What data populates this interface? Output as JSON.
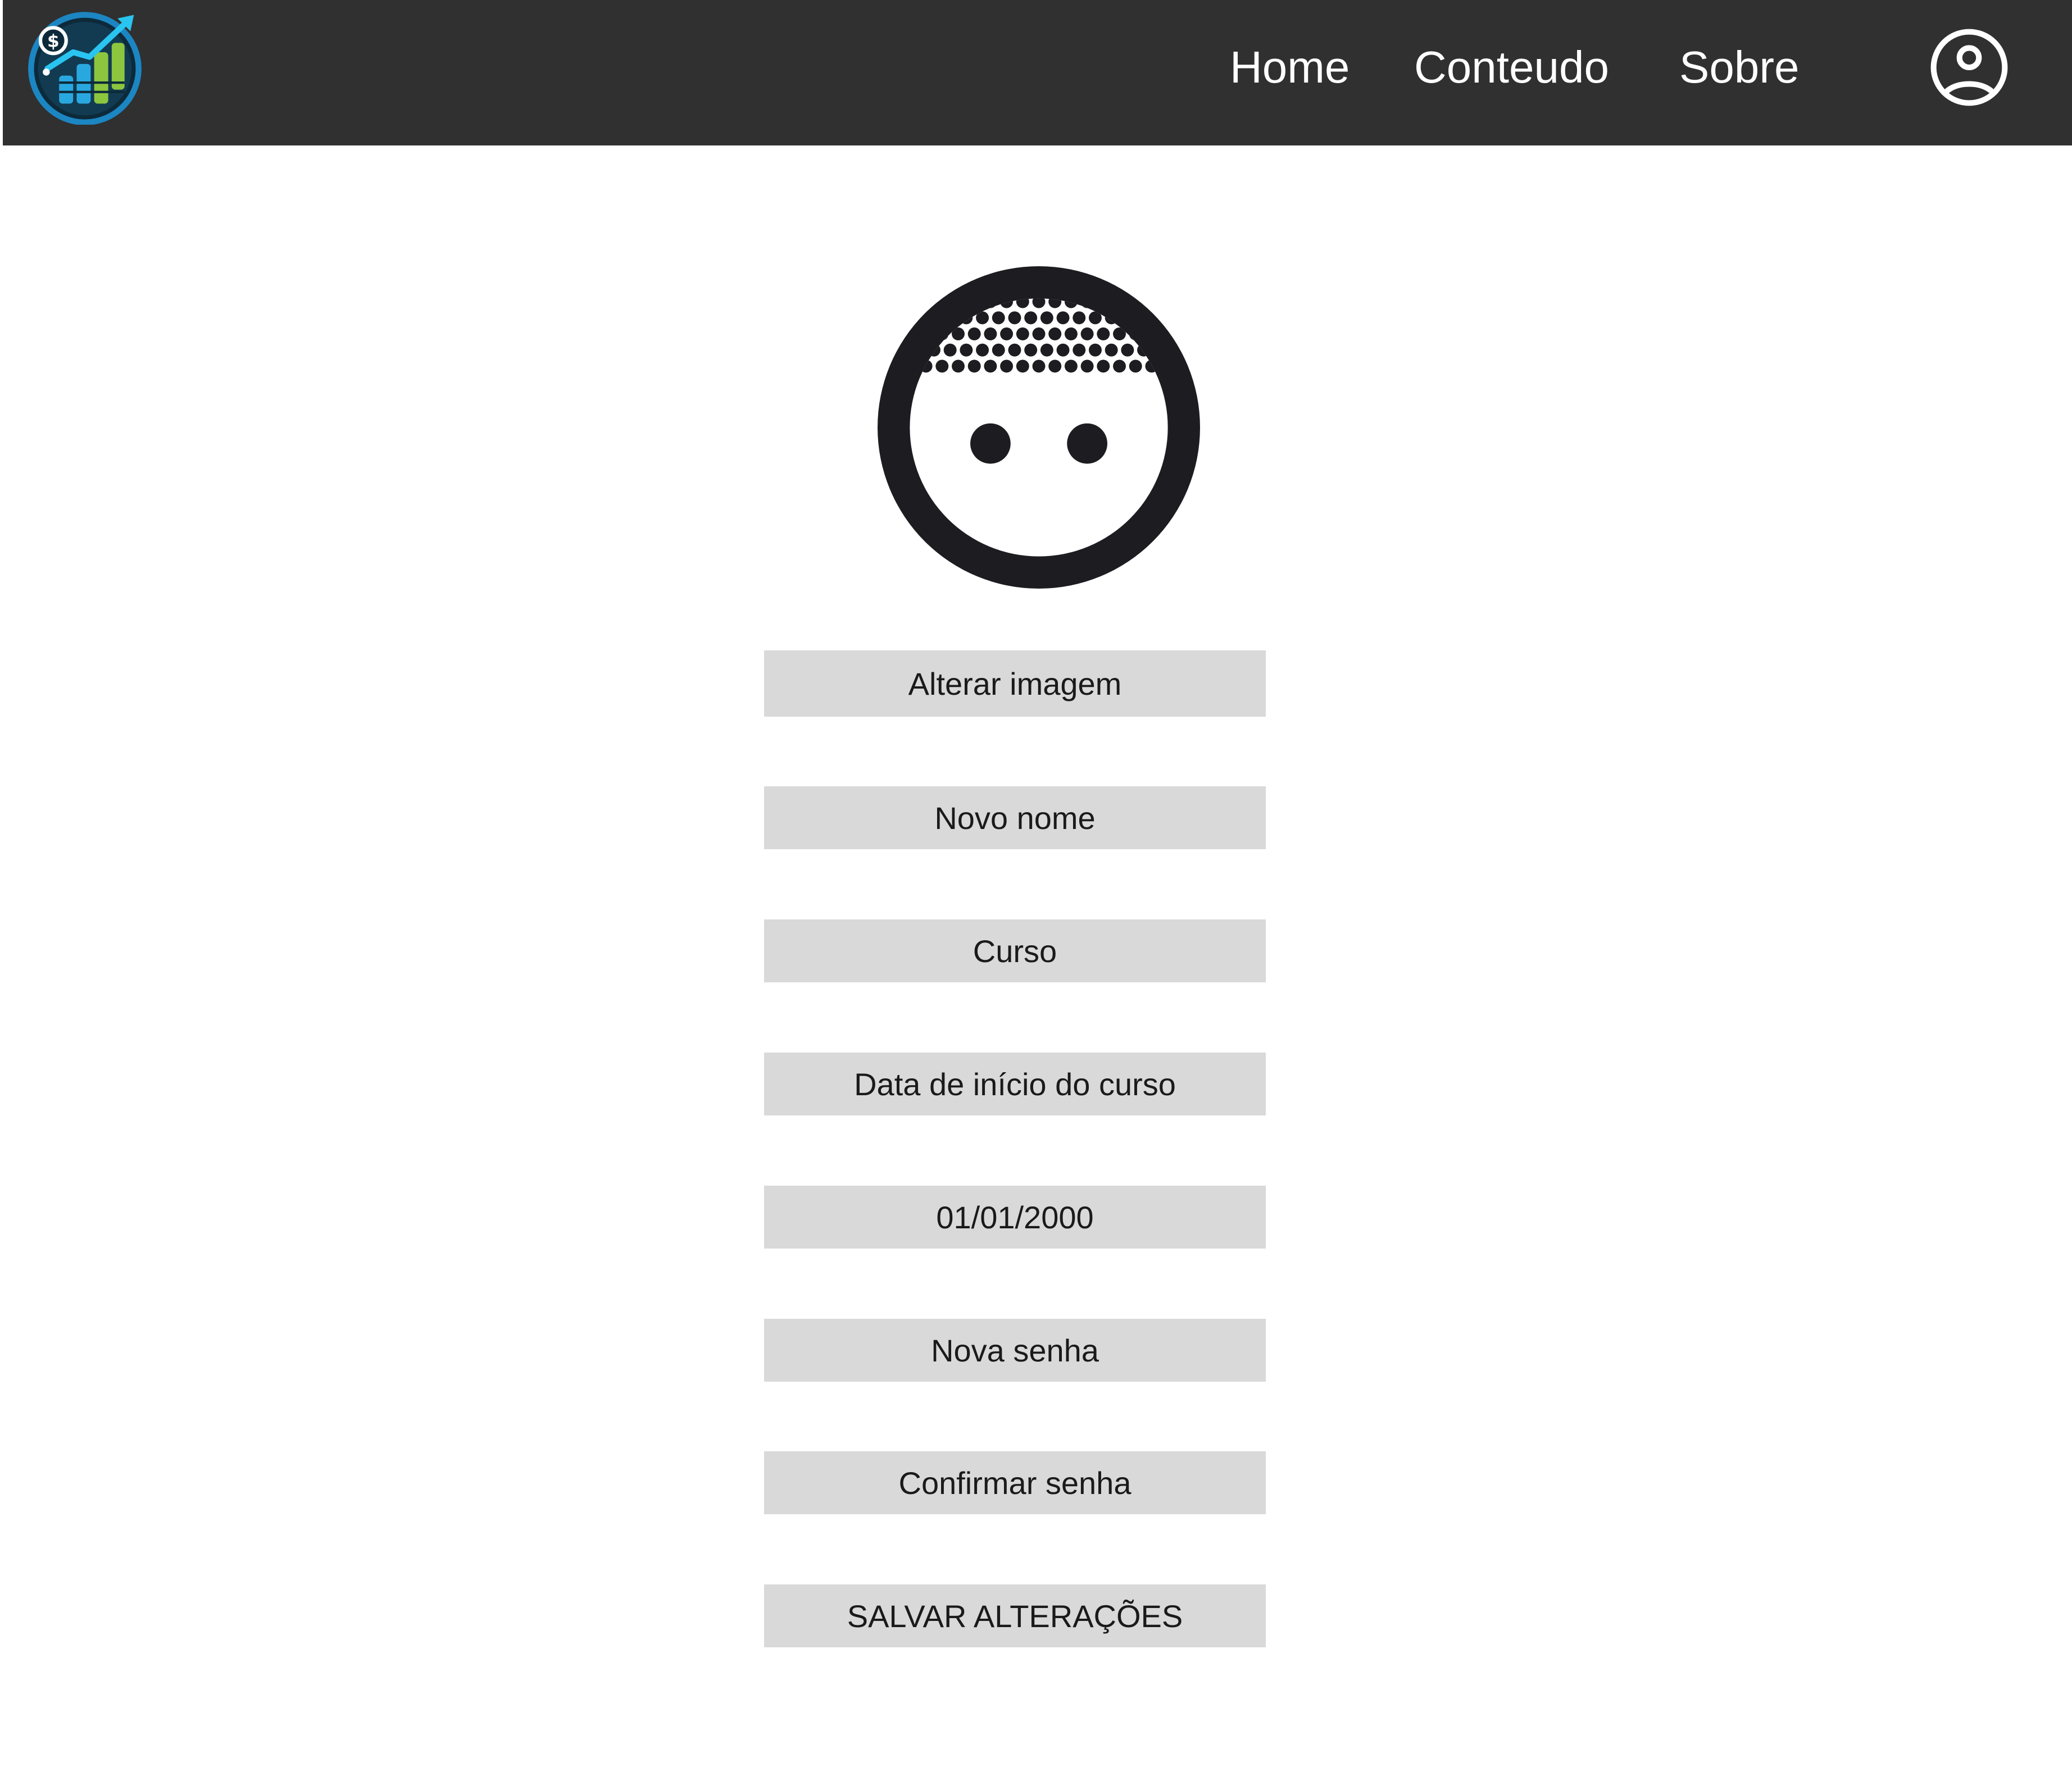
{
  "header": {
    "logo_icon": "finance-chart-coins-logo",
    "nav": [
      {
        "label": "Home"
      },
      {
        "label": "Conteudo"
      },
      {
        "label": "Sobre"
      }
    ],
    "profile_icon": "user-circle-icon"
  },
  "profile": {
    "avatar_icon": "face-avatar-icon",
    "change_image_label": "Alterar imagem",
    "fields": {
      "name_placeholder": "Novo nome",
      "course_placeholder": "Curso",
      "start_date_label": "Data de início do curso",
      "start_date_value": "01/01/2000",
      "new_password_placeholder": "Nova senha",
      "confirm_password_placeholder": "Confirmar senha"
    },
    "save_label": "SALVAR ALTERAÇÕES"
  },
  "colors": {
    "topbar": "#303030",
    "field_bg": "#d9d9d9",
    "text": "#1a1a1a",
    "logo_blue": "#29a8e0",
    "logo_green": "#8cc63f"
  }
}
